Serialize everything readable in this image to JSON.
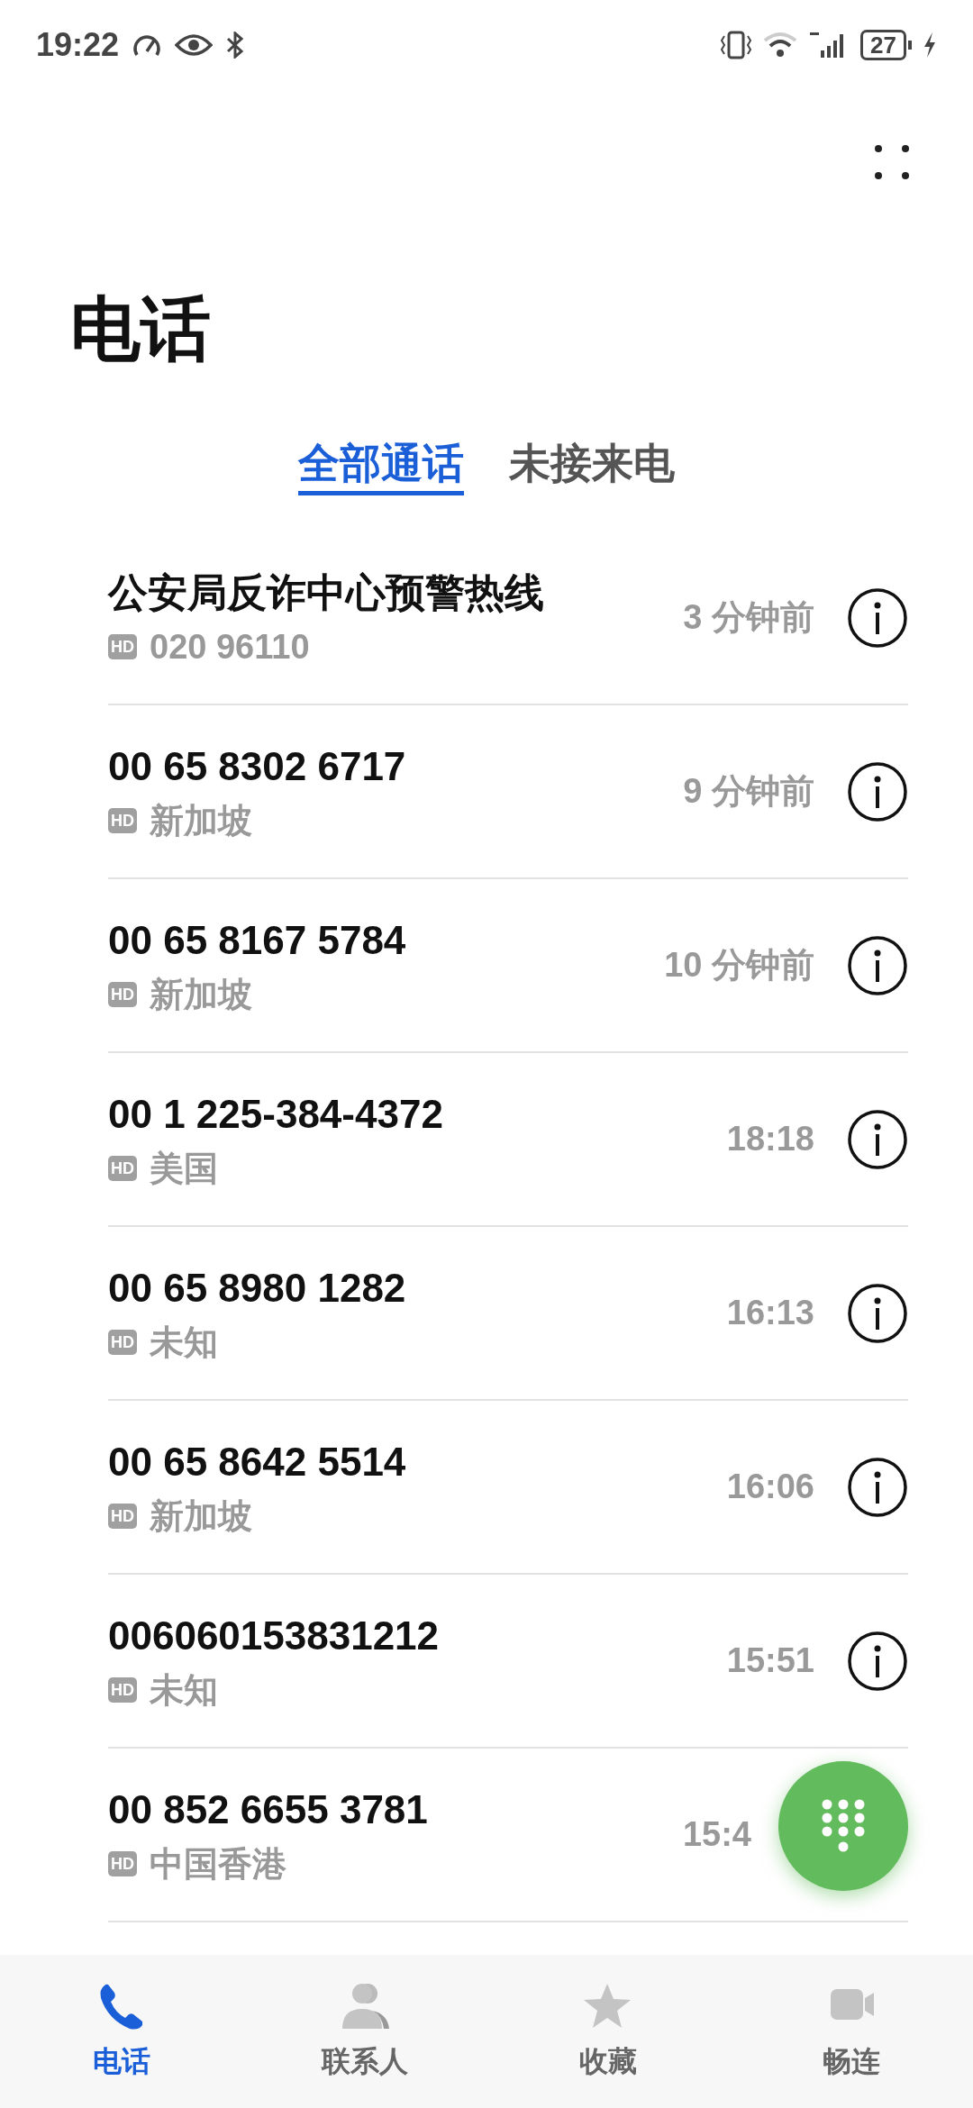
{
  "status_bar": {
    "time": "19:22",
    "battery": "27"
  },
  "title": "电话",
  "tabs": [
    {
      "label": "全部通话",
      "selected": true
    },
    {
      "label": "未接来电",
      "selected": false
    }
  ],
  "calls": [
    {
      "name": "公安局反诈中心预警热线",
      "badge": "HD",
      "detail": "020 96110",
      "time": "3 分钟前",
      "info": true
    },
    {
      "name": "00 65 8302 6717",
      "badge": "HD",
      "detail": "新加坡",
      "time": "9 分钟前",
      "info": true
    },
    {
      "name": "00 65 8167 5784",
      "badge": "HD",
      "detail": "新加坡",
      "time": "10 分钟前",
      "info": true
    },
    {
      "name": "00 1 225-384-4372",
      "badge": "HD",
      "detail": "美国",
      "time": "18:18",
      "info": true
    },
    {
      "name": "00 65 8980 1282",
      "badge": "HD",
      "detail": "未知",
      "time": "16:13",
      "info": true
    },
    {
      "name": "00 65 8642 5514",
      "badge": "HD",
      "detail": "新加坡",
      "time": "16:06",
      "info": true
    },
    {
      "name": "006060153831212",
      "badge": "HD",
      "detail": "未知",
      "time": "15:51",
      "info": true
    },
    {
      "name": "00 852 6655 3781",
      "badge": "HD",
      "detail": "中国香港",
      "time": "15:4",
      "info": false
    }
  ],
  "nav": [
    {
      "label": "电话",
      "kind": "phone",
      "selected": true
    },
    {
      "label": "联系人",
      "kind": "contacts",
      "selected": false
    },
    {
      "label": "收藏",
      "kind": "star",
      "selected": false
    },
    {
      "label": "畅连",
      "kind": "video",
      "selected": false
    }
  ]
}
